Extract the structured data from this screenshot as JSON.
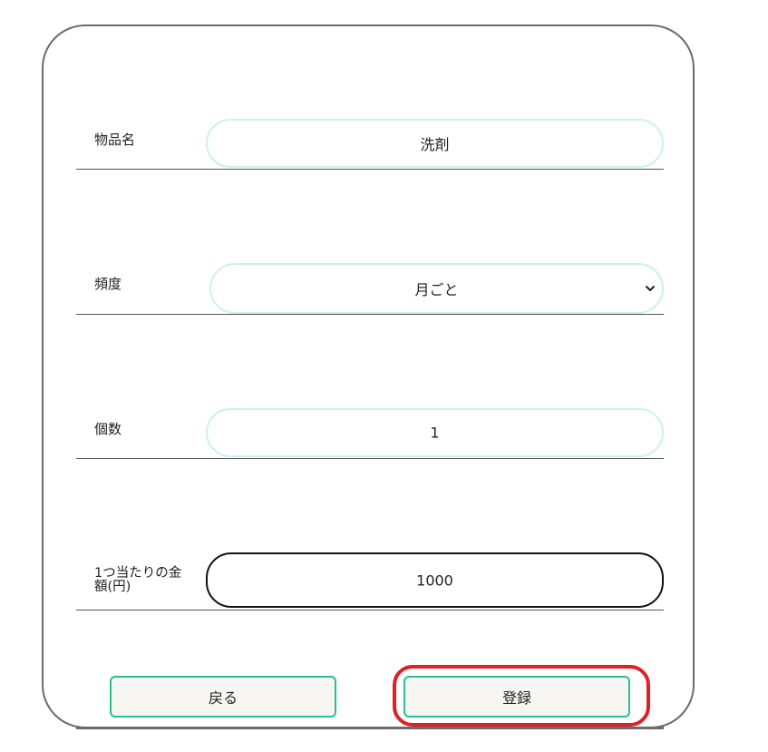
{
  "form": {
    "item_name": {
      "label": "物品名",
      "value": "洗剤"
    },
    "frequency": {
      "label": "頻度",
      "value": "月ごと"
    },
    "quantity": {
      "label": "個数",
      "value": "1"
    },
    "unit_price": {
      "label": "1つ当たりの金額(円)",
      "value": "1000"
    }
  },
  "buttons": {
    "back_label": "戻る",
    "register_label": "登録"
  },
  "colors": {
    "field_border": "#c9f0f6",
    "button_border": "#27c08f",
    "highlight": "#e01f26"
  }
}
